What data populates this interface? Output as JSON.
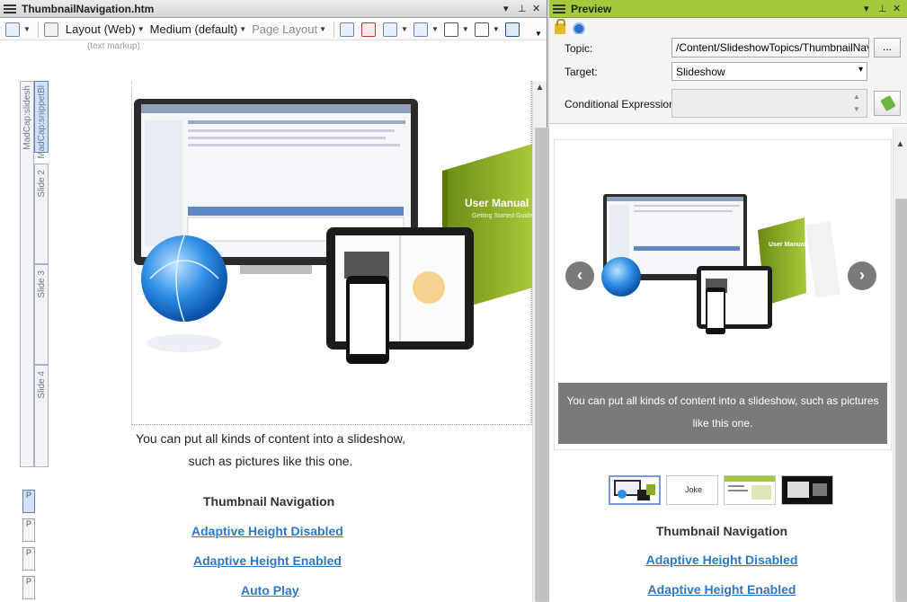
{
  "editor": {
    "title": "ThumbnailNavigation.htm",
    "toolbar": {
      "layout": "Layout (Web)",
      "medium": "Medium (default)",
      "page_layout": "Page Layout"
    },
    "markup_note": "(text markup)",
    "structure": {
      "bars": [
        "MadCap:slidesh",
        "MadCap:snippetBl",
        "Slide 2",
        "Slide 3",
        "Slide 4"
      ],
      "p_label": "P"
    },
    "content": {
      "caption_line1": "You can put all kinds of content into a slideshow,",
      "caption_line2": "such as pictures like this one.",
      "heading": "Thumbnail Navigation",
      "links": [
        "Adaptive Height Disabled",
        "Adaptive Height Enabled",
        "Auto Play"
      ]
    }
  },
  "preview": {
    "title": "Preview",
    "form": {
      "topic_label": "Topic:",
      "topic_value": "/Content/SlideshowTopics/ThumbnailNavigat",
      "browse_label": "...",
      "target_label": "Target:",
      "target_value": "Slideshow",
      "conditional_label": "Conditional Expression:"
    },
    "slideshow": {
      "caption": "You can put all kinds of content into a slideshow, such as pictures like this one.",
      "manual_title": "User Manual",
      "manual_sub": "Getting Started Guide"
    },
    "thumb_text": "Joke",
    "heading": "Thumbnail Navigation",
    "links": [
      "Adaptive Height Disabled",
      "Adaptive Height Enabled"
    ]
  },
  "colors": {
    "preview_title_bg": "#a4c93a",
    "link": "#2a78c6",
    "caption_bg": "#7a7a7a"
  }
}
